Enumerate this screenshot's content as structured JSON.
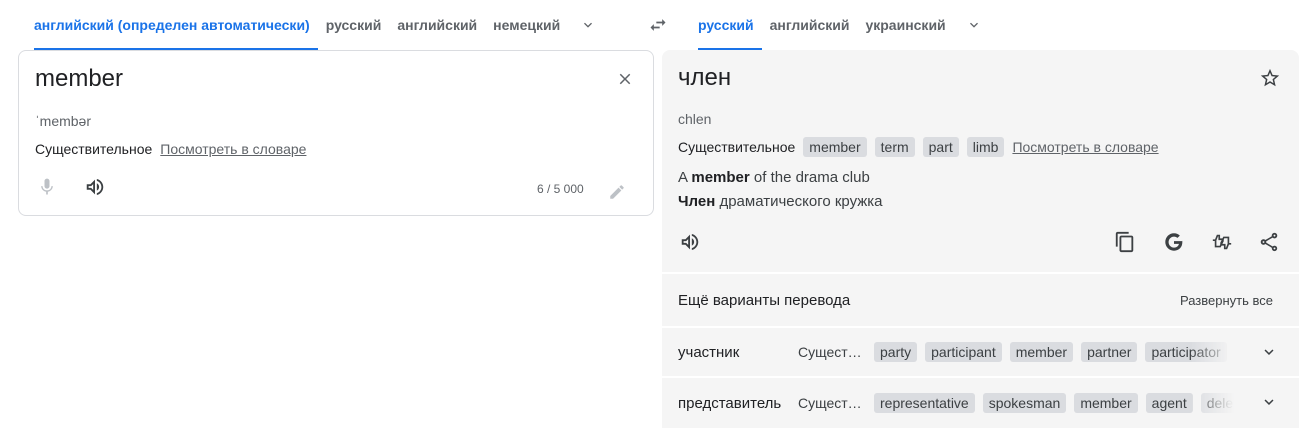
{
  "source_langs": {
    "tabs": [
      "английский (определен автоматически)",
      "русский",
      "английский",
      "немецкий"
    ],
    "expand_icon": "chevron-down-icon"
  },
  "swap_icon": "swap-arrows-icon",
  "target_langs": {
    "tabs": [
      "русский",
      "английский",
      "украинский"
    ],
    "expand_icon": "chevron-down-icon"
  },
  "source": {
    "text": "member",
    "transliteration": "ˈmembər",
    "part_of_speech": "Существительное",
    "dict_link": "Посмотреть в словаре",
    "char_count": "6 / 5 000",
    "icons": [
      "close-icon",
      "microphone-icon",
      "speaker-icon",
      "pencil-icon"
    ]
  },
  "target": {
    "text": "член",
    "transliteration": "chlen",
    "part_of_speech": "Существительное",
    "chips": [
      "member",
      "term",
      "part",
      "limb"
    ],
    "dict_link": "Посмотреть в словаре",
    "example_src": {
      "pre": "A ",
      "bold": "member",
      "post": " of the drama club"
    },
    "example_tgt": {
      "pre": "",
      "bold": "Член",
      "post": " драматического кружка"
    },
    "icons": [
      "star-icon",
      "speaker-icon",
      "copy-icon",
      "google-icon",
      "feedback-icon",
      "share-icon"
    ]
  },
  "more": {
    "title": "Ещё варианты перевода",
    "expand_all": "Развернуть все",
    "rows": [
      {
        "word": "участник",
        "pos": "Сущест…",
        "chips": [
          "party",
          "participant",
          "member",
          "partner",
          "participator"
        ]
      },
      {
        "word": "представитель",
        "pos": "Сущест…",
        "chips": [
          "representative",
          "spokesman",
          "member",
          "agent",
          "delegate"
        ]
      }
    ]
  },
  "colors": {
    "accent": "#1a73e8",
    "panel": "#f5f5f5",
    "chip": "#dadce0"
  }
}
